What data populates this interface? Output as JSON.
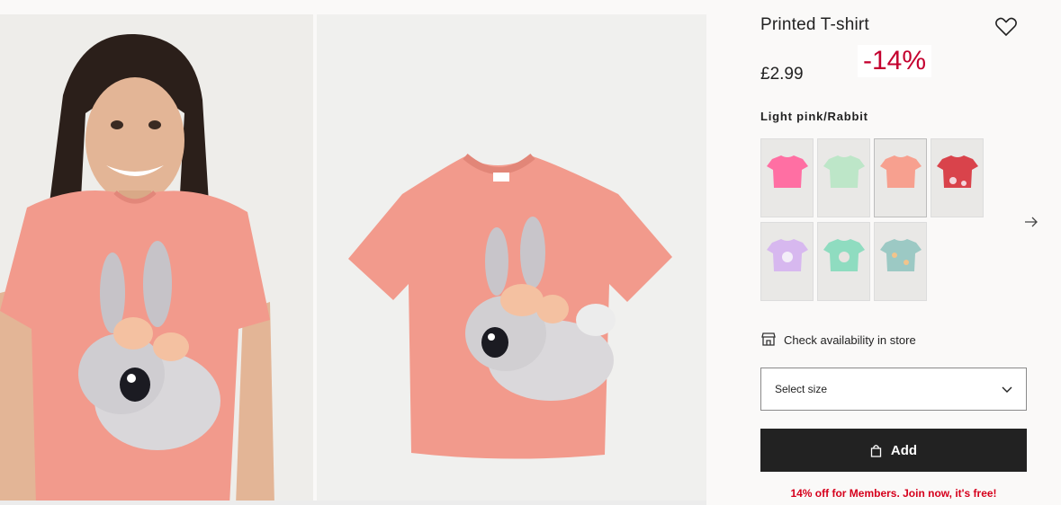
{
  "product": {
    "title": "Printed T-shirt",
    "price": "£2.99",
    "discount": "-14%",
    "color_name": "Light pink/Rabbit"
  },
  "gallery": {
    "images": [
      {
        "name": "model-photo",
        "alt": "Girl wearing light pink rabbit t-shirt"
      },
      {
        "name": "product-photo",
        "alt": "Light pink t-shirt with rabbit print"
      }
    ]
  },
  "swatches": [
    {
      "name": "pink",
      "color": "#ff6fa3",
      "selected": false
    },
    {
      "name": "mint",
      "color": "#bde6c8",
      "selected": false
    },
    {
      "name": "peach",
      "color": "#f7a08f",
      "selected": true
    },
    {
      "name": "red-floral",
      "color": "#d9434b",
      "selected": false
    },
    {
      "name": "lilac-unicorn",
      "color": "#d7b8ef",
      "selected": false
    },
    {
      "name": "mint-bunny",
      "color": "#8fdcc0",
      "selected": false
    },
    {
      "name": "teal-print",
      "color": "#9cc9c4",
      "selected": false
    }
  ],
  "actions": {
    "store_check": "Check availability in store",
    "select_size": "Select size",
    "add": "Add",
    "member_offer": "14% off for Members. Join now, it's free!"
  },
  "icons": {
    "favorite": "heart-icon",
    "next": "arrow-right-icon",
    "store": "store-icon",
    "dropdown": "chevron-down-icon",
    "bag": "shopping-bag-icon"
  },
  "colors": {
    "discount": "#c4002f",
    "member_text": "#d6001c",
    "add_button": "#222222",
    "shirt": "#f29a8c"
  }
}
